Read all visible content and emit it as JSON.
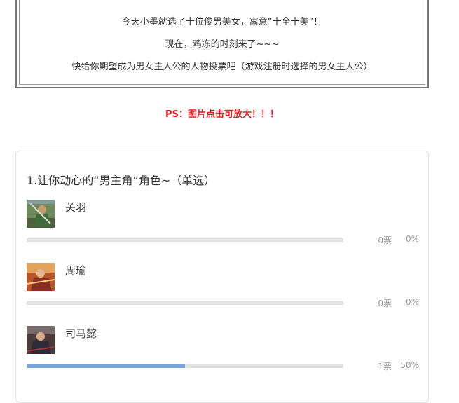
{
  "intro": {
    "line1": "今天小墨就选了十位俊男美女，寓意“十全十美”！",
    "line2": "现在，鸡冻的时刻来了~~~",
    "line3": "快给你期望成为男女主人公的人物投票吧（游戏注册时选择的男女主人公）"
  },
  "ps_note": "PS：图片点击可放大！！！",
  "poll": {
    "question": "1.让你动心的“男主角”角色~（单选）",
    "bar_fill_color": "#7ba7d8",
    "options": [
      {
        "name": "关羽",
        "votes": "0票",
        "percent": "0%",
        "fraction": 0
      },
      {
        "name": "周瑜",
        "votes": "0票",
        "percent": "0%",
        "fraction": 0
      },
      {
        "name": "司马懿",
        "votes": "1票",
        "percent": "50%",
        "fraction": 0.5
      }
    ]
  }
}
